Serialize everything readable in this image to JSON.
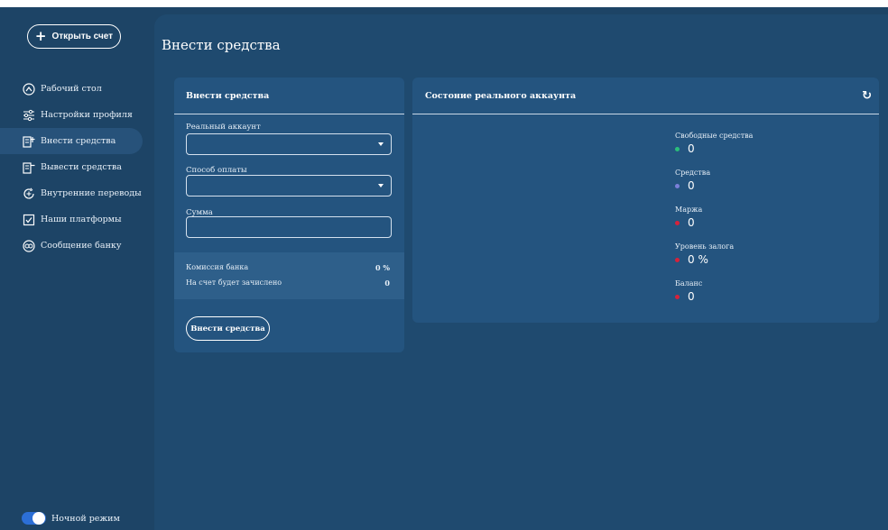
{
  "sidebar": {
    "open_account_label": "Открыть счет",
    "items": [
      {
        "label": "Рабочий стол",
        "icon": "dashboard-icon"
      },
      {
        "label": "Настройки профиля",
        "icon": "sliders-icon"
      },
      {
        "label": "Внести средства",
        "icon": "deposit-icon",
        "active": true
      },
      {
        "label": "Вывести средства",
        "icon": "withdraw-icon"
      },
      {
        "label": "Внутренние переводы",
        "icon": "transfer-icon"
      },
      {
        "label": "Наши платформы",
        "icon": "platform-icon"
      },
      {
        "label": "Сообщение банку",
        "icon": "message-icon"
      }
    ],
    "night_mode_label": "Ночной режим"
  },
  "page": {
    "title": "Внести средства"
  },
  "deposit_card": {
    "title": "Внести средства",
    "account_label": "Реальный аккаунт",
    "account_value": "",
    "method_label": "Способ оплаты",
    "method_value": "",
    "amount_label": "Сумма",
    "amount_value": "",
    "commission_label": "Комиссия банка",
    "commission_value": "0 %",
    "credited_label": "На счет будет зачислено",
    "credited_value": "0",
    "submit_label": "Внести средства"
  },
  "account_card": {
    "title": "Состоние реального аккаунта",
    "stats": [
      {
        "label": "Свободные средства",
        "value": "0",
        "color": "#2bbf7a"
      },
      {
        "label": "Средства",
        "value": "0",
        "color": "#7b7fd9"
      },
      {
        "label": "Маржа",
        "value": "0",
        "color": "#d6223a"
      },
      {
        "label": "Уровень залога",
        "value": "0 %",
        "color": "#d6223a"
      },
      {
        "label": "Баланс",
        "value": "0",
        "color": "#d6223a"
      }
    ]
  },
  "colors": {
    "sidebar_bg": "#1d4466",
    "main_bg": "#1f4a6f",
    "card_bg": "#24547f",
    "toggle": "#2c6fd6"
  }
}
